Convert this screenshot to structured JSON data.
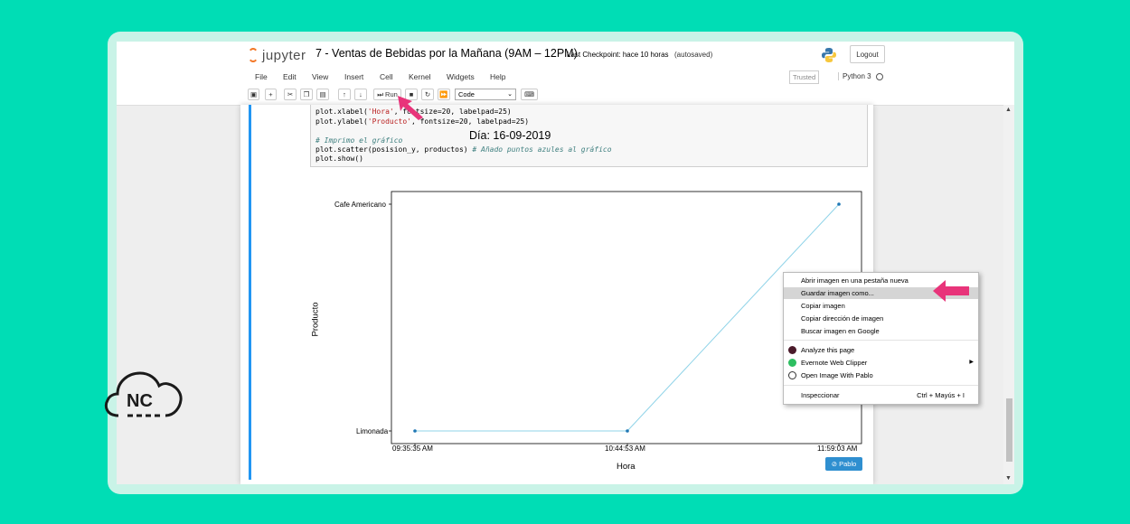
{
  "app": {
    "logo_text": "jupyter",
    "notebook_title": "7 - Ventas de Bebidas por la Mañana (9AM – 12PM)",
    "checkpoint": "Last Checkpoint: hace 10 horas",
    "autosaved": "(autosaved)",
    "logout_label": "Logout",
    "trusted_label": "Trusted",
    "kernel_label": "Python 3"
  },
  "menu": {
    "items": [
      "File",
      "Edit",
      "View",
      "Insert",
      "Cell",
      "Kernel",
      "Widgets",
      "Help"
    ]
  },
  "toolbar": {
    "run_label": "Run",
    "cell_type": "Code"
  },
  "code": {
    "line1a": "plot.xlabel(",
    "line1s": "'Hora'",
    "line1b": ", fontsize=20, labelpad=25)",
    "line2a": "plot.ylabel(",
    "line2s": "'Producto'",
    "line2b": ", fontsize=20, labelpad=25)",
    "line3": "# Imprimo el gráfico",
    "line4a": "plot.scatter(posision_y, productos) ",
    "line4c": "# Añado puntos azules al gráfico",
    "line5": "plot.show()"
  },
  "chart_data": {
    "type": "line",
    "title": "Día: 16-09-2019",
    "xlabel": "Hora",
    "ylabel": "Producto",
    "categories": [
      "09:35:35 AM",
      "10:44:53 AM",
      "11:59:03 AM"
    ],
    "y_categories": [
      "Limonada",
      "Cafe Americano"
    ],
    "series": [
      {
        "x": [
          "09:35:35 AM",
          "10:44:53 AM",
          "11:59:03 AM"
        ],
        "y": [
          "Limonada",
          "Limonada",
          "Cafe Americano"
        ]
      }
    ],
    "grid": false,
    "line_color": "#8fd3e8",
    "point_color": "#1f77b4"
  },
  "pablo_button": "Pablo",
  "context_menu": {
    "items": [
      "Abrir imagen en una pestaña nueva",
      "Guardar imagen como...",
      "Copiar imagen",
      "Copiar dirección de imagen",
      "Buscar imagen en Google",
      "Analyze this page",
      "Evernote Web Clipper",
      "Open Image With Pablo",
      "Inspeccionar"
    ],
    "inspect_shortcut": "Ctrl + Mayús + I"
  },
  "watermark": {
    "text": "NC"
  },
  "colors": {
    "background": "#00ddb5",
    "annotation_arrow": "#e8347a",
    "cell_border": "#2196f3"
  }
}
